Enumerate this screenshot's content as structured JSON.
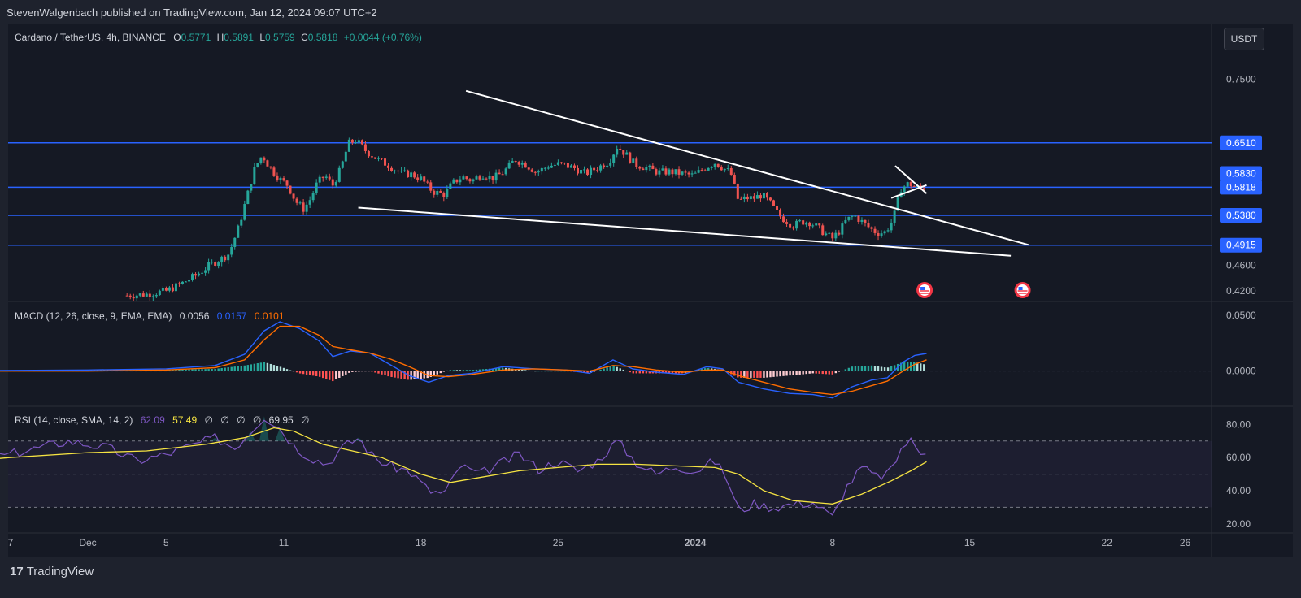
{
  "header": {
    "publisher": "StevenWalgenbach published on TradingView.com, Jan 12, 2024 09:07 UTC+2"
  },
  "currency_button": "USDT",
  "legend": {
    "symbol": "Cardano / TetherUS, 4h, BINANCE",
    "o_label": "O",
    "o_value": "0.5771",
    "h_label": "H",
    "h_value": "0.5891",
    "l_label": "L",
    "l_value": "0.5759",
    "c_label": "C",
    "c_value": "0.5818",
    "change": "+0.0044 (+0.76%)"
  },
  "macd_legend": {
    "label": "MACD (12, 26, close, 9, EMA, EMA)",
    "hist": "0.0056",
    "macd": "0.0157",
    "signal": "0.0101"
  },
  "rsi_legend": {
    "label": "RSI (14, close, SMA, 14, 2)",
    "rsi": "62.09",
    "sma": "57.49",
    "na1": "∅",
    "na2": "∅",
    "na3": "∅",
    "na4": "∅",
    "bb": "69.95",
    "na5": "∅"
  },
  "footer": {
    "logo_mark": "17",
    "logo_text": "TradingView"
  },
  "colors": {
    "up": "#26a69a",
    "down": "#ef5350",
    "level": "#2962ff",
    "trend": "#ffffff",
    "macd": "#2962ff",
    "signal": "#ff6d00",
    "rsi": "#7e57c2",
    "rsi_ma": "#f5e342"
  },
  "chart_data": {
    "type": "candlestick",
    "symbol": "ADAUSDT",
    "timeframe": "4h",
    "price_axis_ticks": [
      "0.7500",
      "0.4600",
      "0.4200"
    ],
    "price_ylim": [
      0.405,
      0.79
    ],
    "horizontal_levels": [
      {
        "label": "0.6510",
        "value": 0.651
      },
      {
        "label": "0.5818",
        "value": 0.5818
      },
      {
        "label": "0.5380",
        "value": 0.538
      },
      {
        "label": "0.4915",
        "value": 0.4915
      }
    ],
    "price_marker": {
      "label": "0.5830",
      "value": 0.583
    },
    "last_price": {
      "label": "0.5818",
      "value": 0.5818
    },
    "x_axis_ticks": [
      {
        "label": "7",
        "day": -24
      },
      {
        "label": "Dec",
        "day": 0
      },
      {
        "label": "5",
        "day": 4
      },
      {
        "label": "11",
        "day": 10
      },
      {
        "label": "18",
        "day": 17
      },
      {
        "label": "25",
        "day": 24
      },
      {
        "label": "2024",
        "day": 31
      },
      {
        "label": "8",
        "day": 38
      },
      {
        "label": "15",
        "day": 45
      },
      {
        "label": "22",
        "day": 52
      },
      {
        "label": "26",
        "day": 56
      }
    ],
    "trendlines": [
      {
        "from": {
          "day": 19.3,
          "price": 0.732
        },
        "to": {
          "day": 48.0,
          "price": 0.492
        }
      },
      {
        "from": {
          "day": 13.8,
          "price": 0.55
        },
        "to": {
          "day": 47.1,
          "price": 0.475
        }
      },
      {
        "from": {
          "day": 41.2,
          "price": 0.615
        },
        "to": {
          "day": 42.8,
          "price": 0.572
        }
      },
      {
        "from": {
          "day": 41.0,
          "price": 0.565
        },
        "to": {
          "day": 42.8,
          "price": 0.585
        }
      }
    ],
    "event_markers": [
      {
        "day": 42.7,
        "label": "US"
      },
      {
        "day": 47.7,
        "label": "US"
      }
    ],
    "macd_axis_ticks": [
      "0.0500",
      "0.0000"
    ],
    "macd_ylim": [
      -0.03,
      0.06
    ],
    "rsi_axis_ticks": [
      "80.00",
      "60.00",
      "40.00",
      "20.00"
    ],
    "rsi_ylim": [
      15,
      90
    ],
    "rsi_bands": [
      70,
      50,
      30
    ],
    "price_path": [
      [
        2.0,
        0.413
      ],
      [
        3.0,
        0.415
      ],
      [
        4.0,
        0.42
      ],
      [
        4.8,
        0.432
      ],
      [
        5.5,
        0.444
      ],
      [
        6.3,
        0.462
      ],
      [
        6.8,
        0.47
      ],
      [
        7.2,
        0.478
      ],
      [
        7.7,
        0.52
      ],
      [
        8.1,
        0.565
      ],
      [
        8.5,
        0.61
      ],
      [
        8.9,
        0.632
      ],
      [
        9.3,
        0.612
      ],
      [
        9.8,
        0.594
      ],
      [
        10.2,
        0.585
      ],
      [
        10.6,
        0.56
      ],
      [
        11.0,
        0.548
      ],
      [
        11.3,
        0.56
      ],
      [
        11.7,
        0.588
      ],
      [
        12.1,
        0.6
      ],
      [
        12.5,
        0.585
      ],
      [
        12.9,
        0.61
      ],
      [
        13.3,
        0.65
      ],
      [
        13.7,
        0.655
      ],
      [
        14.2,
        0.638
      ],
      [
        14.8,
        0.625
      ],
      [
        15.4,
        0.615
      ],
      [
        16.0,
        0.603
      ],
      [
        16.5,
        0.602
      ],
      [
        17.0,
        0.595
      ],
      [
        17.6,
        0.575
      ],
      [
        18.2,
        0.57
      ],
      [
        18.6,
        0.588
      ],
      [
        19.1,
        0.598
      ],
      [
        19.6,
        0.592
      ],
      [
        20.1,
        0.602
      ],
      [
        20.7,
        0.596
      ],
      [
        21.2,
        0.605
      ],
      [
        21.8,
        0.625
      ],
      [
        22.3,
        0.618
      ],
      [
        22.9,
        0.605
      ],
      [
        23.5,
        0.615
      ],
      [
        24.1,
        0.618
      ],
      [
        24.8,
        0.612
      ],
      [
        25.4,
        0.603
      ],
      [
        26.0,
        0.612
      ],
      [
        26.6,
        0.622
      ],
      [
        27.0,
        0.645
      ],
      [
        27.4,
        0.635
      ],
      [
        27.9,
        0.618
      ],
      [
        28.5,
        0.612
      ],
      [
        29.1,
        0.605
      ],
      [
        29.7,
        0.606
      ],
      [
        30.3,
        0.603
      ],
      [
        30.9,
        0.6
      ],
      [
        31.5,
        0.612
      ],
      [
        32.0,
        0.62
      ],
      [
        32.4,
        0.612
      ],
      [
        32.8,
        0.605
      ],
      [
        33.2,
        0.56
      ],
      [
        33.6,
        0.565
      ],
      [
        34.0,
        0.565
      ],
      [
        34.4,
        0.57
      ],
      [
        34.8,
        0.558
      ],
      [
        35.2,
        0.54
      ],
      [
        35.6,
        0.53
      ],
      [
        36.0,
        0.522
      ],
      [
        36.4,
        0.528
      ],
      [
        36.8,
        0.528
      ],
      [
        37.2,
        0.52
      ],
      [
        37.6,
        0.51
      ],
      [
        38.0,
        0.502
      ],
      [
        38.4,
        0.515
      ],
      [
        38.7,
        0.53
      ],
      [
        39.1,
        0.538
      ],
      [
        39.5,
        0.528
      ],
      [
        39.9,
        0.518
      ],
      [
        40.3,
        0.51
      ],
      [
        40.7,
        0.512
      ],
      [
        41.1,
        0.532
      ],
      [
        41.5,
        0.58
      ],
      [
        41.9,
        0.588
      ],
      [
        42.2,
        0.582
      ],
      [
        42.5,
        0.58
      ],
      [
        42.8,
        0.5818
      ]
    ],
    "macd_path": [
      [
        -24.0,
        0.0
      ],
      [
        -10.0,
        0.0
      ],
      [
        0.0,
        0.001
      ],
      [
        4.0,
        0.002
      ],
      [
        6.5,
        0.005
      ],
      [
        8.0,
        0.015
      ],
      [
        9.0,
        0.036
      ],
      [
        9.8,
        0.044
      ],
      [
        10.8,
        0.038
      ],
      [
        11.8,
        0.027
      ],
      [
        12.5,
        0.013
      ],
      [
        13.4,
        0.018
      ],
      [
        14.4,
        0.016
      ],
      [
        15.4,
        0.006
      ],
      [
        16.4,
        -0.004
      ],
      [
        17.4,
        -0.01
      ],
      [
        18.4,
        -0.004
      ],
      [
        19.6,
        -0.002
      ],
      [
        21.2,
        0.004
      ],
      [
        22.8,
        0.002
      ],
      [
        24.4,
        0.001
      ],
      [
        25.6,
        -0.002
      ],
      [
        26.8,
        0.01
      ],
      [
        27.8,
        0.002
      ],
      [
        29.0,
        -0.001
      ],
      [
        30.4,
        -0.003
      ],
      [
        31.6,
        0.004
      ],
      [
        32.4,
        0.002
      ],
      [
        33.2,
        -0.01
      ],
      [
        34.5,
        -0.016
      ],
      [
        35.8,
        -0.02
      ],
      [
        37.0,
        -0.021
      ],
      [
        38.0,
        -0.024
      ],
      [
        39.0,
        -0.014
      ],
      [
        40.0,
        -0.008
      ],
      [
        40.8,
        -0.006
      ],
      [
        41.6,
        0.008
      ],
      [
        42.2,
        0.014
      ],
      [
        42.8,
        0.0157
      ]
    ],
    "signal_path": [
      [
        -24.0,
        0.0
      ],
      [
        -10.0,
        0.0
      ],
      [
        0.0,
        0.0
      ],
      [
        4.0,
        0.001
      ],
      [
        6.5,
        0.003
      ],
      [
        8.0,
        0.01
      ],
      [
        9.0,
        0.028
      ],
      [
        9.8,
        0.04
      ],
      [
        10.8,
        0.04
      ],
      [
        11.8,
        0.032
      ],
      [
        12.5,
        0.022
      ],
      [
        13.4,
        0.019
      ],
      [
        14.4,
        0.016
      ],
      [
        15.4,
        0.011
      ],
      [
        16.4,
        0.004
      ],
      [
        17.4,
        -0.004
      ],
      [
        18.4,
        -0.005
      ],
      [
        19.6,
        -0.003
      ],
      [
        21.2,
        0.001
      ],
      [
        22.8,
        0.002
      ],
      [
        24.4,
        0.001
      ],
      [
        25.6,
        0.0
      ],
      [
        26.8,
        0.005
      ],
      [
        27.8,
        0.004
      ],
      [
        29.0,
        0.001
      ],
      [
        30.4,
        -0.001
      ],
      [
        31.6,
        0.001
      ],
      [
        32.4,
        0.001
      ],
      [
        33.2,
        -0.004
      ],
      [
        34.5,
        -0.01
      ],
      [
        35.8,
        -0.016
      ],
      [
        37.0,
        -0.019
      ],
      [
        38.0,
        -0.021
      ],
      [
        39.0,
        -0.018
      ],
      [
        40.0,
        -0.013
      ],
      [
        40.8,
        -0.009
      ],
      [
        41.6,
        0.0
      ],
      [
        42.2,
        0.006
      ],
      [
        42.8,
        0.0101
      ]
    ],
    "rsi_path": [
      [
        -24.0,
        52
      ],
      [
        -22.0,
        45
      ],
      [
        -19.0,
        55
      ],
      [
        -16.0,
        48
      ],
      [
        -12.0,
        60
      ],
      [
        -8.0,
        50
      ],
      [
        -4.0,
        62
      ],
      [
        -1.0,
        70
      ],
      [
        1.0,
        66
      ],
      [
        2.5,
        58
      ],
      [
        4.0,
        62
      ],
      [
        5.5,
        68
      ],
      [
        6.5,
        72
      ],
      [
        7.5,
        66
      ],
      [
        8.3,
        76
      ],
      [
        9.0,
        85
      ],
      [
        9.8,
        78
      ],
      [
        10.6,
        66
      ],
      [
        11.4,
        60
      ],
      [
        12.2,
        56
      ],
      [
        13.0,
        66
      ],
      [
        13.8,
        72
      ],
      [
        14.6,
        60
      ],
      [
        15.4,
        55
      ],
      [
        16.4,
        52
      ],
      [
        17.4,
        40
      ],
      [
        18.2,
        38
      ],
      [
        19.0,
        55
      ],
      [
        20.0,
        50
      ],
      [
        21.0,
        56
      ],
      [
        22.0,
        62
      ],
      [
        23.0,
        53
      ],
      [
        24.0,
        58
      ],
      [
        25.0,
        52
      ],
      [
        26.0,
        58
      ],
      [
        27.0,
        70
      ],
      [
        28.0,
        57
      ],
      [
        29.0,
        50
      ],
      [
        30.0,
        55
      ],
      [
        31.0,
        52
      ],
      [
        32.0,
        58
      ],
      [
        32.6,
        48
      ],
      [
        33.2,
        28
      ],
      [
        34.0,
        32
      ],
      [
        35.0,
        30
      ],
      [
        36.0,
        32
      ],
      [
        37.0,
        33
      ],
      [
        38.0,
        24
      ],
      [
        38.7,
        42
      ],
      [
        39.5,
        54
      ],
      [
        40.3,
        48
      ],
      [
        41.0,
        52
      ],
      [
        41.6,
        68
      ],
      [
        42.0,
        70
      ],
      [
        42.4,
        64
      ],
      [
        42.8,
        62.09
      ]
    ],
    "rsi_ma_path": [
      [
        -24.0,
        50
      ],
      [
        -20.0,
        49
      ],
      [
        -16.0,
        50
      ],
      [
        -12.0,
        54
      ],
      [
        -8.0,
        56
      ],
      [
        -4.0,
        60
      ],
      [
        0.0,
        63
      ],
      [
        3.0,
        64
      ],
      [
        6.0,
        68
      ],
      [
        8.0,
        72
      ],
      [
        9.5,
        78
      ],
      [
        10.5,
        76
      ],
      [
        12.0,
        68
      ],
      [
        13.5,
        64
      ],
      [
        15.0,
        60
      ],
      [
        17.0,
        50
      ],
      [
        18.5,
        45
      ],
      [
        20.0,
        48
      ],
      [
        22.0,
        52
      ],
      [
        24.0,
        54
      ],
      [
        26.0,
        56
      ],
      [
        28.0,
        56
      ],
      [
        30.0,
        55
      ],
      [
        32.0,
        54
      ],
      [
        33.2,
        50
      ],
      [
        34.5,
        40
      ],
      [
        36.0,
        34
      ],
      [
        38.0,
        32
      ],
      [
        39.5,
        38
      ],
      [
        41.0,
        46
      ],
      [
        42.0,
        52
      ],
      [
        42.8,
        57.49
      ]
    ]
  }
}
